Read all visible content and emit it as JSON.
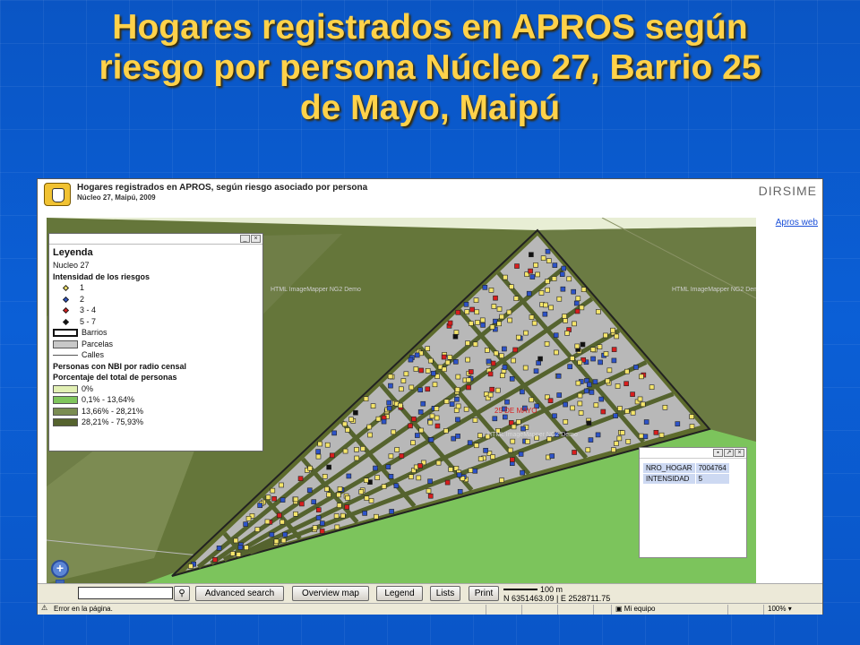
{
  "slide": {
    "title_line1": "Hogares registrados en APROS según",
    "title_line2": "riesgo por persona Núcleo 27, Barrio 25",
    "title_line3": "de Mayo, Maipú"
  },
  "app": {
    "title": "Hogares registrados en APROS, según riesgo asociado por persona",
    "subtitle": "Núcleo 27, Maipú, 2009",
    "brand": "DIRSIME",
    "apros_link": "Apros web",
    "watermark": "HTML ImageMapper NG2 Demo",
    "map_label": "25 DE MAYO"
  },
  "legend": {
    "title": "Leyenda",
    "layer": "Nucleo 27",
    "risk_heading": "Intensidad de los riesgos",
    "risk_items": [
      {
        "label": "1",
        "color": "#f5e56b"
      },
      {
        "label": "2",
        "color": "#2d53c8"
      },
      {
        "label": "3 - 4",
        "color": "#d81e1e"
      },
      {
        "label": "5 - 7",
        "color": "#111111"
      }
    ],
    "barrios": "Barrios",
    "parcelas": "Parcelas",
    "calles": "Calles",
    "nbi_heading": "Personas con NBI por radio censal",
    "pct_heading": "Porcentaje del total de personas",
    "nbi_classes": [
      {
        "label": "0%",
        "color": "#e2f0b4"
      },
      {
        "label": "0,1% - 13,64%",
        "color": "#7fc55c"
      },
      {
        "label": "13,66% - 28,21%",
        "color": "#7a8c52"
      },
      {
        "label": "28,21% - 75,93%",
        "color": "#55632e"
      }
    ]
  },
  "info": {
    "rows": [
      {
        "field": "NRO_HOGAR",
        "value": "7004764"
      },
      {
        "field": "INTENSIDAD",
        "value": "5"
      }
    ]
  },
  "toolbar": {
    "search_value": "",
    "advanced_search": "Advanced search",
    "overview_map": "Overview map",
    "legend": "Legend",
    "lists": "Lists",
    "print": "Print",
    "scale": "100 m",
    "coords": "N 6351463.09 | E 2528711.75"
  },
  "status": {
    "error": "Error en la página.",
    "zone": "Mi equipo",
    "zoom": "100%"
  }
}
